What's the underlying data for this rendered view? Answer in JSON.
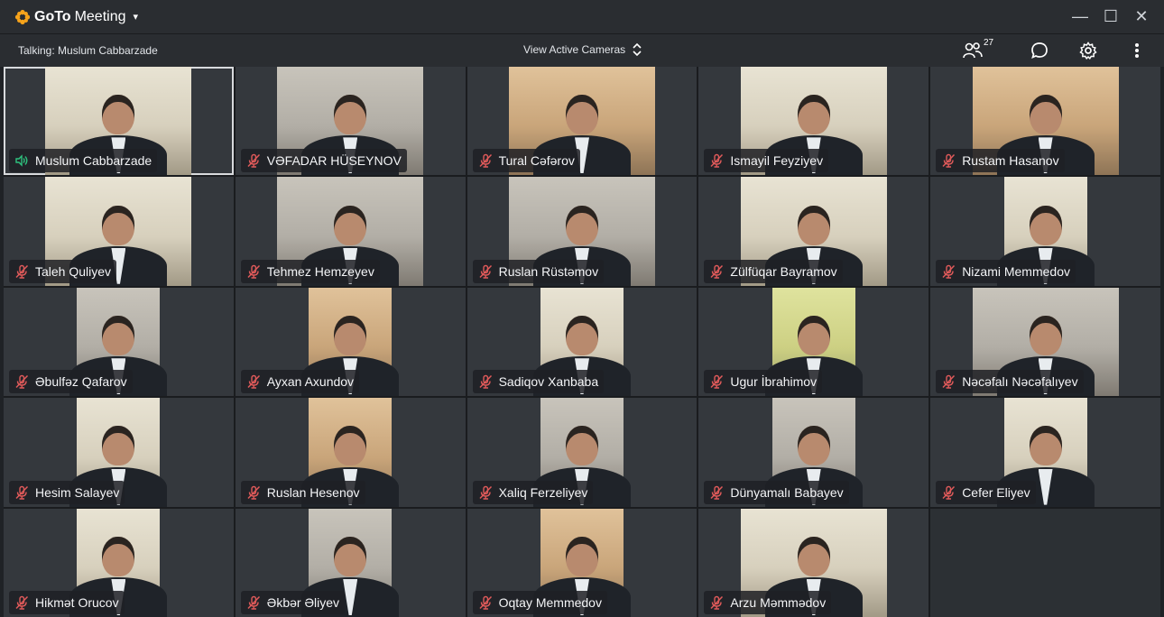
{
  "app": {
    "brand_goto": "GoTo",
    "brand_meeting": "Meeting",
    "caret": "▾",
    "window_controls": [
      "—",
      "☐",
      "✕"
    ]
  },
  "toolbar": {
    "talking": "Talking: Muslum Cabbarzade",
    "view_cameras": "View Active Cameras",
    "attendee_count": "27",
    "icons": [
      "people-icon",
      "chat-icon",
      "settings-icon",
      "more-icon"
    ]
  },
  "colors": {
    "brand_orange": "#f6a31b",
    "speaking_green": "#2ec27e",
    "muted_red": "#e05a5a",
    "background": "#1f2226"
  },
  "participants": [
    {
      "name": "Muslum Cabbarzade",
      "speaking": true
    },
    {
      "name": "VƏFADAR HÜSEYNOV",
      "speaking": false
    },
    {
      "name": "Tural Cəfərov",
      "speaking": false
    },
    {
      "name": "Ismayil Feyziyev",
      "speaking": false
    },
    {
      "name": "Rustam Hasanov",
      "speaking": false
    },
    {
      "name": "Taleh Quliyev",
      "speaking": false
    },
    {
      "name": "Tehmez  Hemzeyev",
      "speaking": false
    },
    {
      "name": "Ruslan Rüstəmov",
      "speaking": false
    },
    {
      "name": "Zülfüqar Bayramov",
      "speaking": false
    },
    {
      "name": "Nizami Memmedov",
      "speaking": false
    },
    {
      "name": "Əbulfəz Qafarov",
      "speaking": false
    },
    {
      "name": "Ayxan Axundov",
      "speaking": false
    },
    {
      "name": "Sadiqov Xanbaba",
      "speaking": false
    },
    {
      "name": "Ugur İbrahimov",
      "speaking": false
    },
    {
      "name": "Nəcəfalı Nəcəfalıyev",
      "speaking": false
    },
    {
      "name": "Hesim Salayev",
      "speaking": false
    },
    {
      "name": "Ruslan Hesenov",
      "speaking": false
    },
    {
      "name": "Xaliq Ferzeliyev",
      "speaking": false
    },
    {
      "name": "Dünyamalı Babayev",
      "speaking": false
    },
    {
      "name": "Cefer Eliyev",
      "speaking": false
    },
    {
      "name": "Hikmət Orucov",
      "speaking": false
    },
    {
      "name": "Əkbər Əliyev",
      "speaking": false
    },
    {
      "name": "Oqtay Memmedov",
      "speaking": false
    },
    {
      "name": "Arzu Məmmədov",
      "speaking": false
    }
  ]
}
